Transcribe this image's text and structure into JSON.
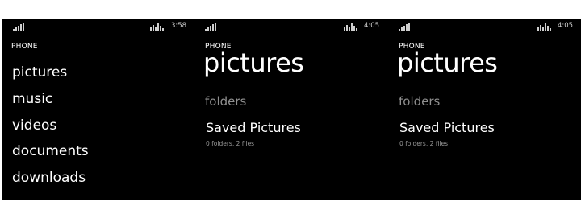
{
  "colors": {
    "background": "#000000",
    "text": "#ffffff",
    "muted": "#8f8f8f",
    "page": "#ffffff"
  },
  "panel1": {
    "status": {
      "time": "3:58",
      "icons": [
        "signal-icon",
        "wifi-icon"
      ]
    },
    "location": "PHONE",
    "items": [
      {
        "label": "pictures"
      },
      {
        "label": "music"
      },
      {
        "label": "videos"
      },
      {
        "label": "documents"
      },
      {
        "label": "downloads"
      }
    ]
  },
  "panel2": {
    "status": {
      "time": "4:05",
      "icons": [
        "signal-icon",
        "wifi-icon"
      ]
    },
    "location": "PHONE",
    "title": "pictures",
    "section": "folders",
    "folder": {
      "name": "Saved Pictures",
      "meta": "0 folders, 2 files"
    }
  },
  "panel3": {
    "status": {
      "time": "4:05",
      "icons": [
        "signal-icon",
        "wifi-icon"
      ]
    },
    "location": "PHONE",
    "title": "pictures",
    "section": "folders",
    "folder": {
      "name": "Saved Pictures",
      "meta": "0 folders, 2 files"
    }
  }
}
